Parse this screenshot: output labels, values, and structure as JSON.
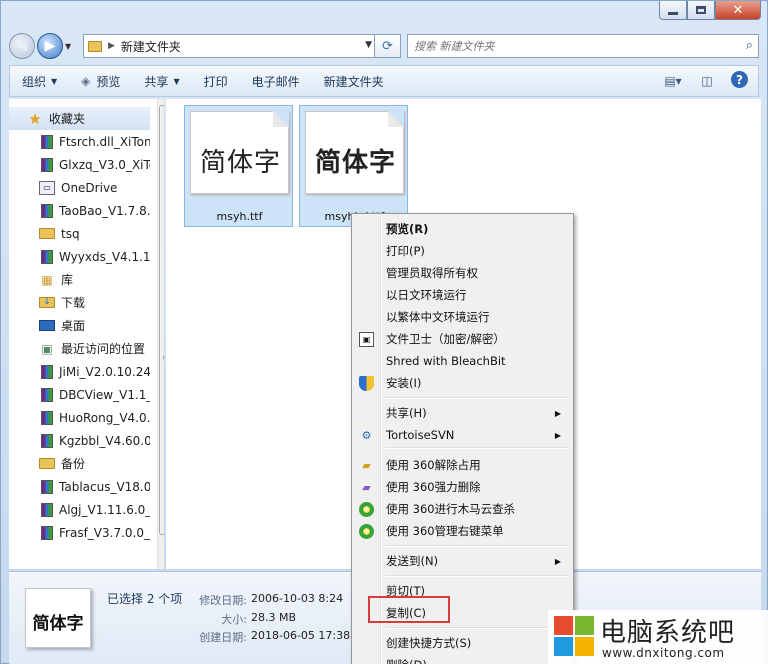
{
  "address": {
    "current_folder": "新建文件夹"
  },
  "search": {
    "placeholder": "搜索 新建文件夹"
  },
  "toolbar": {
    "organize": "组织",
    "preview": "预览",
    "share": "共享",
    "print": "打印",
    "email": "电子邮件",
    "new_folder": "新建文件夹"
  },
  "nav_pane": {
    "favorites": "收藏夹",
    "items": [
      {
        "label": "Ftsrch.dll_XiTon",
        "icon": "winrar-archive-icon"
      },
      {
        "label": "Glxzq_V3.0_XiTo",
        "icon": "winrar-archive-icon"
      },
      {
        "label": "OneDrive",
        "icon": "onedrive-icon"
      },
      {
        "label": "TaoBao_V1.7.8.",
        "icon": "winrar-archive-icon"
      },
      {
        "label": "tsq",
        "icon": "folder-icon"
      },
      {
        "label": "Wyyxds_V4.1.1.:",
        "icon": "winrar-archive-icon"
      },
      {
        "label": "库",
        "icon": "library-icon"
      },
      {
        "label": "下载",
        "icon": "downloads-folder-icon"
      },
      {
        "label": "桌面",
        "icon": "desktop-icon"
      },
      {
        "label": "最近访问的位置",
        "icon": "recent-places-icon"
      },
      {
        "label": "JiMi_V2.0.10.24_",
        "icon": "winrar-archive-icon"
      },
      {
        "label": "DBCView_V1.1_",
        "icon": "winrar-archive-icon"
      },
      {
        "label": "HuoRong_V4.0.",
        "icon": "winrar-archive-icon"
      },
      {
        "label": "Kgzbbl_V4.60.0",
        "icon": "winrar-archive-icon"
      },
      {
        "label": "备份",
        "icon": "folder-icon"
      },
      {
        "label": "Tablacus_V18.0",
        "icon": "winrar-archive-icon"
      },
      {
        "label": "Algj_V1.11.6.0_X",
        "icon": "winrar-archive-icon"
      },
      {
        "label": "Frasf_V3.7.0.0_X",
        "icon": "winrar-archive-icon"
      }
    ],
    "libraries": "库"
  },
  "files": [
    {
      "name": "msyh.ttf",
      "preview_text": "简体字"
    },
    {
      "name": "msyhbd.ttf",
      "preview_text": "简体字"
    }
  ],
  "details": {
    "thumb_text": "简体字",
    "selection": "已选择 2 个项",
    "modified_label": "修改日期:",
    "modified_value": "2006-10-03 8:24",
    "size_label": "大小:",
    "size_value": "28.3 MB",
    "created_label": "创建日期:",
    "created_value": "2018-06-05 17:38"
  },
  "context_menu": {
    "items": [
      {
        "label": "预览(R)",
        "bold": true
      },
      {
        "label": "打印(P)"
      },
      {
        "label": "管理员取得所有权"
      },
      {
        "label": "以日文环境运行"
      },
      {
        "label": "以繁体中文环境运行"
      },
      {
        "label": "文件卫士（加密/解密）",
        "icon": "file-guard-icon"
      },
      {
        "label": "Shred with BleachBit"
      },
      {
        "label": "安装(I)",
        "icon": "uac-shield-icon"
      },
      {
        "label": "共享(H)",
        "submenu": true
      },
      {
        "label": "TortoiseSVN",
        "icon": "tortoisesvn-icon",
        "submenu": true
      },
      {
        "label": "使用 360解除占用",
        "icon": "360-unlock-icon"
      },
      {
        "label": "使用 360强力删除",
        "icon": "360-shred-icon"
      },
      {
        "label": "使用 360进行木马云查杀",
        "icon": "360-scan-icon"
      },
      {
        "label": "使用 360管理右键菜单",
        "icon": "360-menu-icon"
      },
      {
        "label": "发送到(N)",
        "submenu": true
      },
      {
        "label": "剪切(T)"
      },
      {
        "label": "复制(C)",
        "highlighted": true
      },
      {
        "label": "创建快捷方式(S)"
      },
      {
        "label": "删除(D)"
      }
    ]
  },
  "watermark": {
    "title": "电脑系统吧",
    "url": "www.dnxitong.com"
  },
  "colors": {
    "highlight_box": "#d93a3a",
    "selection_fill": "#cde3f7",
    "accent": "#2f66b5"
  }
}
